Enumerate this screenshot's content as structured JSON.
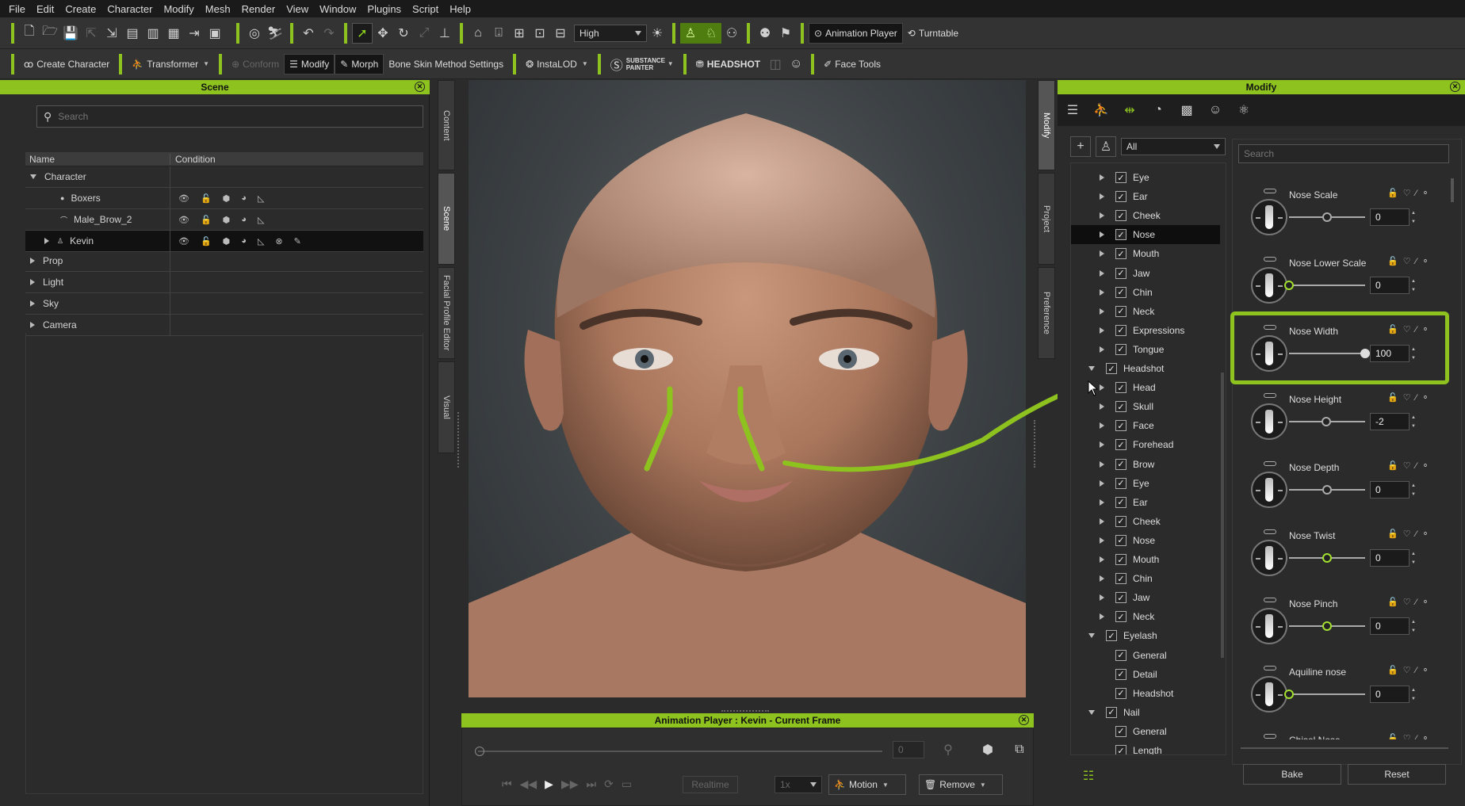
{
  "menu": [
    "File",
    "Edit",
    "Create",
    "Character",
    "Modify",
    "Mesh",
    "Render",
    "View",
    "Window",
    "Plugins",
    "Script",
    "Help"
  ],
  "toolbar1": {
    "quality_select": "High",
    "animation_player_label": "Animation Player",
    "turntable_label": "Turntable"
  },
  "toolbar2": {
    "create_character": "Create Character",
    "transformer": "Transformer",
    "conform": "Conform",
    "modify": "Modify",
    "morph": "Morph",
    "bone_skin": "Bone Skin Method Settings",
    "instalod": "InstaLOD",
    "substance": "SUBSTANCE PAINTER",
    "headshot": "HEADSHOT",
    "face_tools": "Face Tools"
  },
  "scene": {
    "title": "Scene",
    "search_placeholder": "Search",
    "col_name": "Name",
    "col_condition": "Condition",
    "rows": [
      {
        "label": "Character",
        "expand": "down"
      },
      {
        "label": "Boxers",
        "expand": "none"
      },
      {
        "label": "Male_Brow_2",
        "expand": "none"
      },
      {
        "label": "Kevin",
        "expand": "right"
      },
      {
        "label": "Prop",
        "expand": "right"
      },
      {
        "label": "Light",
        "expand": "right"
      },
      {
        "label": "Sky",
        "expand": "right"
      },
      {
        "label": "Camera",
        "expand": "right"
      }
    ]
  },
  "left_vtabs": [
    "Content",
    "Scene",
    "Facial Profile Editor",
    "Visual"
  ],
  "right_vtabs": [
    "Modify",
    "Project",
    "Preference"
  ],
  "animation_player": {
    "title": "Animation Player : Kevin - Current Frame",
    "frame": "0",
    "realtime": "Realtime",
    "speed": "1x",
    "motion": "Motion",
    "remove": "Remove"
  },
  "modify": {
    "title": "Modify",
    "filter": "All",
    "search_placeholder": "Search",
    "tree": [
      {
        "label": "Eye",
        "level": 1
      },
      {
        "label": "Ear",
        "level": 1
      },
      {
        "label": "Cheek",
        "level": 1
      },
      {
        "label": "Nose",
        "level": 1
      },
      {
        "label": "Mouth",
        "level": 1
      },
      {
        "label": "Jaw",
        "level": 1
      },
      {
        "label": "Chin",
        "level": 1
      },
      {
        "label": "Neck",
        "level": 1
      },
      {
        "label": "Expressions",
        "level": 1
      },
      {
        "label": "Tongue",
        "level": 1
      },
      {
        "label": "Headshot",
        "level": 0
      },
      {
        "label": "Head",
        "level": 1
      },
      {
        "label": "Skull",
        "level": 1
      },
      {
        "label": "Face",
        "level": 1
      },
      {
        "label": "Forehead",
        "level": 1
      },
      {
        "label": "Brow",
        "level": 1
      },
      {
        "label": "Eye",
        "level": 1
      },
      {
        "label": "Ear",
        "level": 1
      },
      {
        "label": "Cheek",
        "level": 1
      },
      {
        "label": "Nose",
        "level": 1
      },
      {
        "label": "Mouth",
        "level": 1
      },
      {
        "label": "Chin",
        "level": 1
      },
      {
        "label": "Jaw",
        "level": 1
      },
      {
        "label": "Neck",
        "level": 1
      },
      {
        "label": "Eyelash",
        "level": 0
      },
      {
        "label": "General",
        "level": 2
      },
      {
        "label": "Detail",
        "level": 2
      },
      {
        "label": "Headshot",
        "level": 2
      },
      {
        "label": "Nail",
        "level": 0
      },
      {
        "label": "General",
        "level": 2
      },
      {
        "label": "Length",
        "level": 2
      }
    ],
    "sliders": [
      {
        "label": "Nose Scale",
        "value": "0",
        "pos": 0.5
      },
      {
        "label": "Nose Lower Scale",
        "value": "0",
        "pos": 0.0
      },
      {
        "label": "Nose Width",
        "value": "100",
        "pos": 1.0
      },
      {
        "label": "Nose Height",
        "value": "-2",
        "pos": 0.49
      },
      {
        "label": "Nose Depth",
        "value": "0",
        "pos": 0.5
      },
      {
        "label": "Nose Twist",
        "value": "0",
        "pos": 0.5
      },
      {
        "label": "Nose Pinch",
        "value": "0",
        "pos": 0.5
      },
      {
        "label": "Aquiline nose",
        "value": "0",
        "pos": 0.0
      },
      {
        "label": "Chisel Nose",
        "value": "",
        "pos": 0.5
      }
    ],
    "bake": "Bake",
    "reset": "Reset"
  },
  "colors": {
    "accent": "#8dc21f"
  }
}
